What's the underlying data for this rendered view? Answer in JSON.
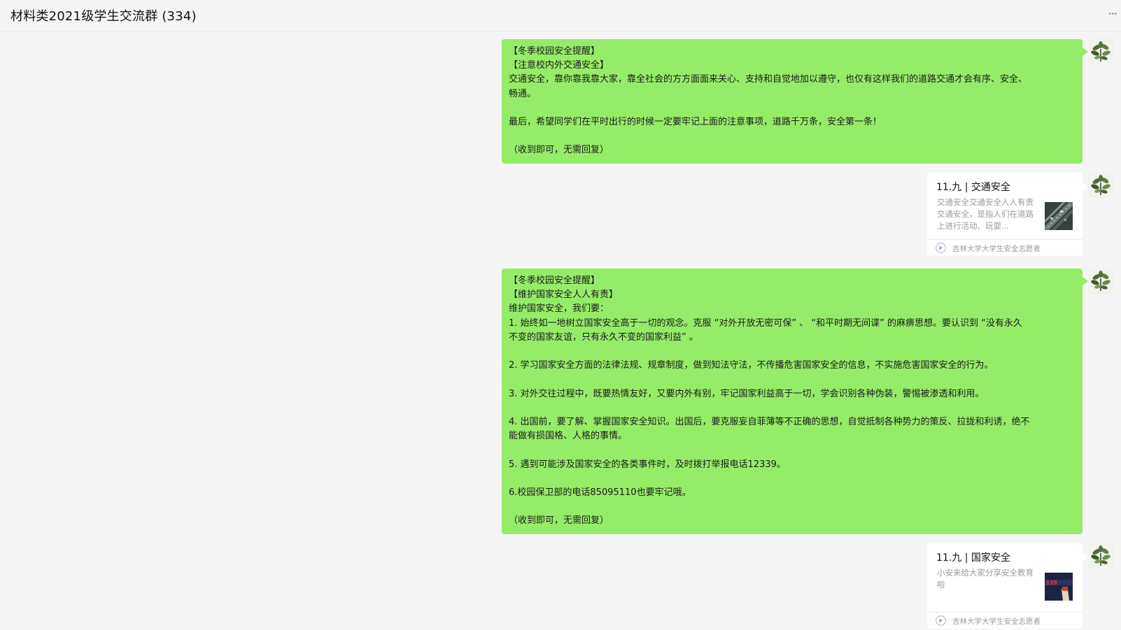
{
  "header": {
    "title": "材料类2021级学生交流群 (334)",
    "more_label": "···"
  },
  "messages": [
    {
      "type": "text",
      "lines": [
        "【冬季校园安全提醒】",
        "【注意校内外交通安全】",
        "交通安全，靠你靠我靠大家，靠全社会的方方面面来关心、支持和自觉地加以遵守，也仅有这样我们的道路交通才会有序、安全、",
        "畅通。",
        "",
        "最后，希望同学们在平时出行的时候一定要牢记上面的注意事项，道路千万条，安全第一条！",
        "",
        "（收到即可，无需回复）"
      ]
    },
    {
      "type": "card",
      "title": "11.九 | 交通安全",
      "desc": "交通安全交通安全人人有责交通安全，是指人们在道路上进行活动、玩耍...",
      "source": "吉林大学大学生安全志愿者",
      "thumb_icon": "traffic-road-thumbnail"
    },
    {
      "type": "text",
      "lines": [
        "【冬季校园安全提醒】",
        "【维护国家安全人人有责】",
        "维护国家安全，我们要：",
        "1. 始终如一地树立国家安全高于一切的观念。克服 “对外开放无密可保” 、 “和平时期无间谍” 的麻痹思想。要认识到 “没有永久",
        "不变的国家友谊，只有永久不变的国家利益” 。",
        "",
        "2. 学习国家安全方面的法律法规、规章制度，做到知法守法，不传播危害国家安全的信息，不实施危害国家安全的行为。",
        "",
        "3. 对外交往过程中，既要热情友好，又要内外有别，牢记国家利益高于一切，学会识别各种伪装，警惕被渗透和利用。",
        "",
        "4. 出国前，要了解、掌握国家安全知识。出国后，要克服妄自菲薄等不正确的思想，自觉抵制各种势力的策反、拉拢和利诱，绝不",
        "能做有损国格、人格的事情。",
        "",
        "5. 遇到可能涉及国家安全的各类事件时，及时拨打举报电话12339。",
        "",
        "6.校园保卫部的电话85095110也要牢记哦。",
        "",
        "（收到即可，无需回复）"
      ]
    },
    {
      "type": "card",
      "title": "11.九 | 国家安全",
      "desc": "小安来给大家分享安全教育啦",
      "source": "吉林大学大学生安全志愿者",
      "thumb_icon": "12339-hotline-thumbnail"
    }
  ],
  "colors": {
    "background": "#f5f5f5",
    "self_bubble": "#95ec69",
    "card": "#ffffff",
    "muted_text": "#9a9a9a"
  }
}
